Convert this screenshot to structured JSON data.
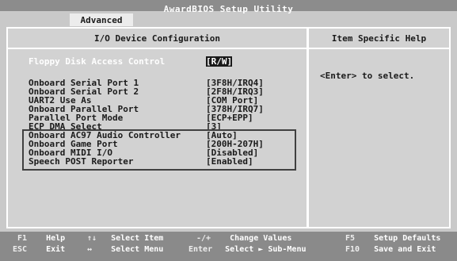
{
  "app_title": "AwardBIOS Setup Utility",
  "tab": "Advanced",
  "panel_title": "I/O Device Configuration",
  "help_title": "Item Specific Help",
  "help_text": "<Enter> to select.",
  "items": [
    {
      "label": "Floppy Disk Access Control",
      "value": "[R/W]"
    },
    {
      "label": "Onboard Serial Port 1",
      "value": "[3F8H/IRQ4]"
    },
    {
      "label": "Onboard Serial Port 2",
      "value": "[2F8H/IRQ3]"
    },
    {
      "label": "UART2 Use As",
      "value": "[COM Port]"
    },
    {
      "label": "Onboard Parallel Port",
      "value": "[378H/IRQ7]"
    },
    {
      "label": "Parallel Port Mode",
      "value": "[ECP+EPP]"
    },
    {
      "label": "ECP DMA Select",
      "value": "[3]"
    },
    {
      "label": "Onboard AC97 Audio Controller",
      "value": "[Auto]"
    },
    {
      "label": "Onboard Game Port",
      "value": "[200H-207H]"
    },
    {
      "label": "Onboard MIDI I/O",
      "value": "[Disabled]"
    },
    {
      "label": "Speech POST Reporter",
      "value": "[Enabled]"
    }
  ],
  "footer": [
    {
      "key": "F1",
      "desc": "Help"
    },
    {
      "key": "ESC",
      "desc": "Exit"
    },
    {
      "key": "↑↓",
      "desc": "Select Item"
    },
    {
      "key": "↔",
      "desc": "Select Menu"
    },
    {
      "key": "-/+",
      "desc": "Change Values"
    },
    {
      "key": "Enter",
      "desc": "Select ► Sub-Menu"
    },
    {
      "key": "F5",
      "desc": "Setup Defaults"
    },
    {
      "key": "F10",
      "desc": "Save and Exit"
    }
  ]
}
